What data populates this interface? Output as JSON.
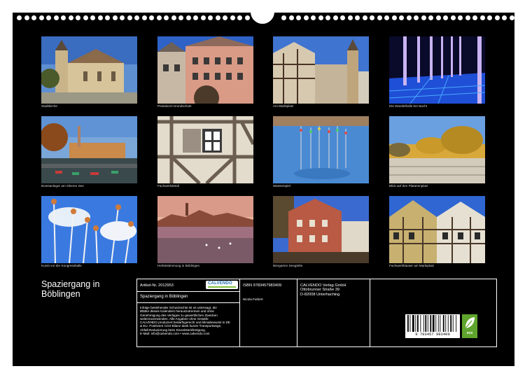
{
  "calendar": {
    "title_line1": "Spaziergang in",
    "title_line2": "Böblingen"
  },
  "photos": [
    {
      "caption": "Stadtkirche",
      "icon": "church-photo"
    },
    {
      "caption": "Pestalozzi-Grundschule",
      "icon": "school-photo"
    },
    {
      "caption": "Am Marktplatz",
      "icon": "market-photo"
    },
    {
      "caption": "Die Wandelhalle bei Nacht",
      "icon": "night-hall-photo"
    },
    {
      "caption": "Bootsanleger am Oberen See",
      "icon": "lake-photo"
    },
    {
      "caption": "Fachwerkdetail",
      "icon": "timber-photo"
    },
    {
      "caption": "Wasserspiel",
      "icon": "water-photo"
    },
    {
      "caption": "Blick auf den Platanenplatz",
      "icon": "square-photo"
    },
    {
      "caption": "Kunst vor der Kongresshalle",
      "icon": "art-photo"
    },
    {
      "caption": "Herbststimmung in Böblingen",
      "icon": "autumn-photo"
    },
    {
      "caption": "Biergarten Seegärtle",
      "icon": "beergarden-photo"
    },
    {
      "caption": "Fachwerkhäuser am Marktplatz",
      "icon": "timber-houses-photo"
    }
  ],
  "info": {
    "article": "Artikel-Nr. 2012953",
    "brand": "CALVENDO",
    "title": "Spaziergang in Böblingen",
    "legal_lines": [
      "Infolge bestehender Schutzrechte ist es untersagt, die",
      "Blätter dieses Kalenders herauszutrennen und ohne",
      "Genehmigung des Verlages zu gewerblichen Zwecken",
      "weiterzuverwenden. Alle Angaben ohne Gewähr.",
      "CALVENDO produziert bedarfsgerecht und klimabewusst in DE",
      "& EU. Positivere CO2-Bilanz dank kurzer Transportwege,",
      "Abfall-Reduzierung beim Einzelstückfertigung.",
      "E-Mail: info@calvendo.com • www.calvendo.com"
    ],
    "isbn": "ISBN 9783457983409",
    "author": "Nicola Furkert",
    "publisher_lines": [
      "CALVENDO Verlag GmbH",
      "Ottobrunner Straße 39",
      "D-82008 Unterhaching"
    ],
    "barcode_number": "9 783457 983409",
    "eco_label": "eco"
  },
  "colors": {
    "background": "#000000",
    "brand_blue": "#1a6fb5",
    "eco_green": "#5fa52d"
  }
}
